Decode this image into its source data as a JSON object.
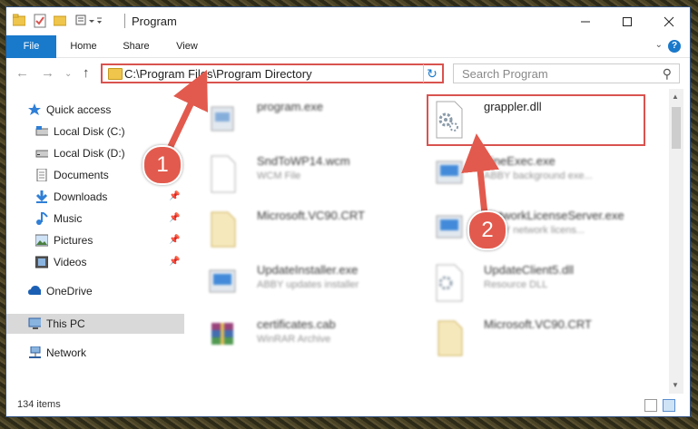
{
  "window": {
    "title": "Program"
  },
  "ribbon": {
    "tabs": [
      "File",
      "Home",
      "Share",
      "View"
    ],
    "help": "?"
  },
  "navbar": {
    "address": "C:\\Program Files\\Program Directory",
    "search_placeholder": "Search Program"
  },
  "sidebar": {
    "items": [
      {
        "label": "Quick access",
        "icon": "star-icon",
        "pinned": false
      },
      {
        "label": "Local Disk (C:)",
        "icon": "drive-icon",
        "pinned": false
      },
      {
        "label": "Local Disk (D:)",
        "icon": "drive-icon",
        "pinned": false
      },
      {
        "label": "Documents",
        "icon": "documents-icon",
        "pinned": false
      },
      {
        "label": "Downloads",
        "icon": "download-icon",
        "pinned": true
      },
      {
        "label": "Music",
        "icon": "music-icon",
        "pinned": true
      },
      {
        "label": "Pictures",
        "icon": "pictures-icon",
        "pinned": true
      },
      {
        "label": "Videos",
        "icon": "videos-icon",
        "pinned": true
      },
      {
        "label": "OneDrive",
        "icon": "cloud-icon",
        "pinned": false
      },
      {
        "label": "This PC",
        "icon": "computer-icon",
        "pinned": false,
        "selected": true
      },
      {
        "label": "Network",
        "icon": "network-icon",
        "pinned": false
      }
    ]
  },
  "files": {
    "left": [
      {
        "name": "program.exe",
        "sub": ""
      },
      {
        "name": "SndToWP14.wcm",
        "sub": "WCM File"
      },
      {
        "name": "Microsoft.VC90.CRT",
        "sub": ""
      },
      {
        "name": "UpdateInstaller.exe",
        "sub": "ABBY updates installer"
      },
      {
        "name": "certificates.cab",
        "sub": "WinRAR Archive"
      }
    ],
    "right": [
      {
        "name": "grappler.dll",
        "sub": ""
      },
      {
        "name": "FineExec.exe",
        "sub": "ABBY background exe..."
      },
      {
        "name": "NetworkLicenseServer.exe",
        "sub": "ABBY network licens..."
      },
      {
        "name": "UpdateClient5.dll",
        "sub": "Resource DLL"
      },
      {
        "name": "Microsoft.VC90.CRT",
        "sub": ""
      }
    ]
  },
  "status": {
    "item_count": "134 items"
  },
  "annotations": {
    "step1": "1",
    "step2": "2",
    "color": "#e25a4d"
  }
}
